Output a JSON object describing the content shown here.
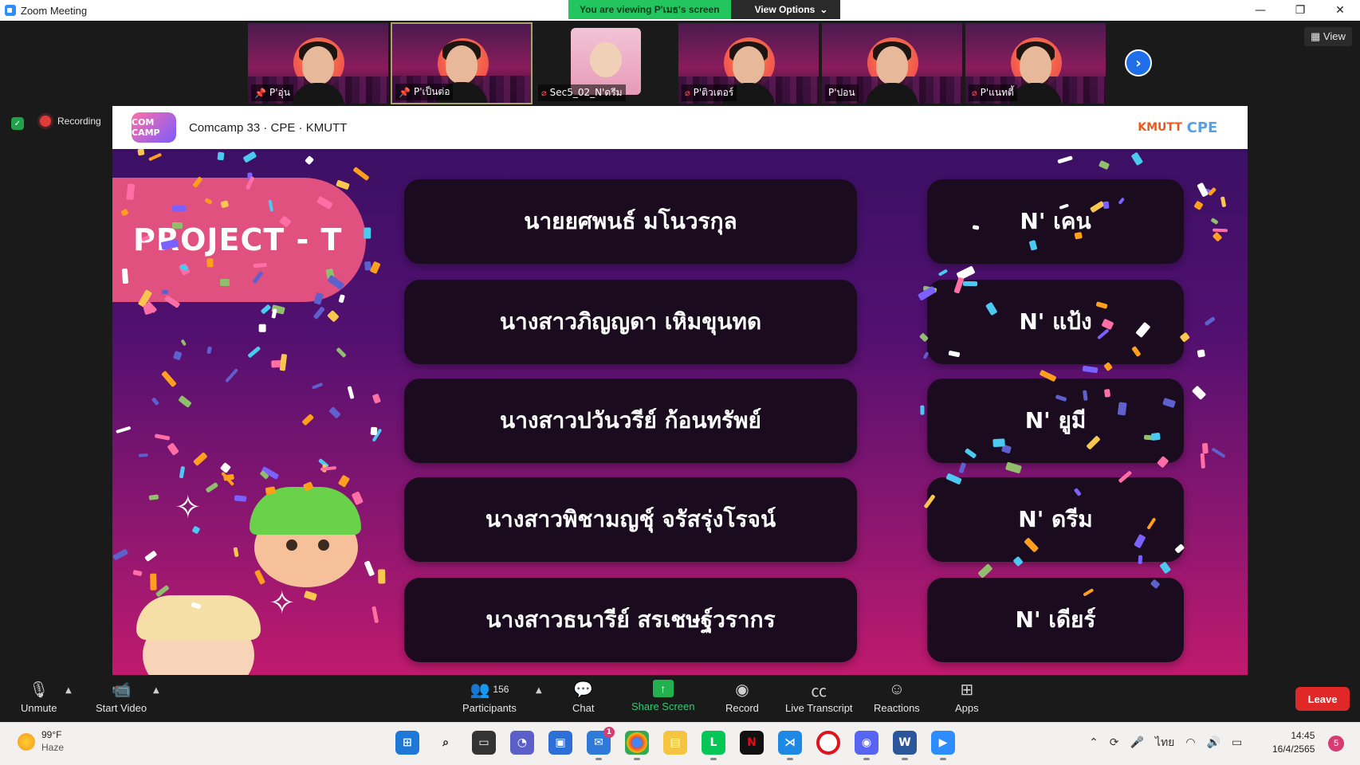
{
  "window": {
    "title": "Zoom Meeting",
    "minimize": "—",
    "restore": "❐",
    "close": "✕"
  },
  "banner": {
    "viewing": "You are viewing P'เมธ's screen",
    "options": "View Options"
  },
  "gallery": {
    "participants": [
      {
        "name": "P'อุ่น",
        "type": "video"
      },
      {
        "name": "P'เป็นต่อ",
        "type": "video",
        "active": true
      },
      {
        "name": "Sec5_02_N'ดรีม",
        "type": "photo",
        "muted": true
      },
      {
        "name": "P'ติวเตอร์",
        "type": "video",
        "muted": true
      },
      {
        "name": "P'ปอน",
        "type": "video"
      },
      {
        "name": "P'แนทตี้",
        "type": "video",
        "muted": true
      }
    ],
    "view_label": "View"
  },
  "status": {
    "recording": "Recording"
  },
  "shared_screen": {
    "header": {
      "camp_logo": "COM CAMP",
      "camp_name": "Comcamp 33 · CPE · KMUTT",
      "kmutt": "KMUTT",
      "cpe": "CPE"
    },
    "slide": {
      "project": "PROJECT - T",
      "rows": [
        {
          "name": "นายยศพนธ์ มโนวรกุล",
          "nick": "N' เคน"
        },
        {
          "name": "นางสาวภิญญดา เหิมขุนทด",
          "nick": "N' แป้ง"
        },
        {
          "name": "นางสาวปวันวรีย์ ก้อนทรัพย์",
          "nick": "N' ยูมี"
        },
        {
          "name": "นางสาวพิชามญชุ์ จรัสรุ่งโรจน์",
          "nick": "N' ดรีม"
        },
        {
          "name": "นางสาวธนารีย์ สรเชษฐ์วรากร",
          "nick": "N' เดียร์"
        }
      ]
    }
  },
  "toolbar": {
    "unmute": "Unmute",
    "start_video": "Start Video",
    "participants": "Participants",
    "participant_count": "156",
    "chat": "Chat",
    "share_screen": "Share Screen",
    "record": "Record",
    "live_transcript": "Live Transcript",
    "reactions": "Reactions",
    "apps": "Apps",
    "leave": "Leave"
  },
  "taskbar": {
    "weather_temp": "99°F",
    "weather_desc": "Haze",
    "language": "ไทย",
    "time": "14:45",
    "date": "16/4/2565",
    "notifications": "5",
    "mail_badge": "1"
  },
  "colors": {
    "share_green": "#22c55e",
    "leave_red": "#e02828",
    "slide_pink": "#e0517f",
    "accent_blue": "#1f6feb"
  }
}
